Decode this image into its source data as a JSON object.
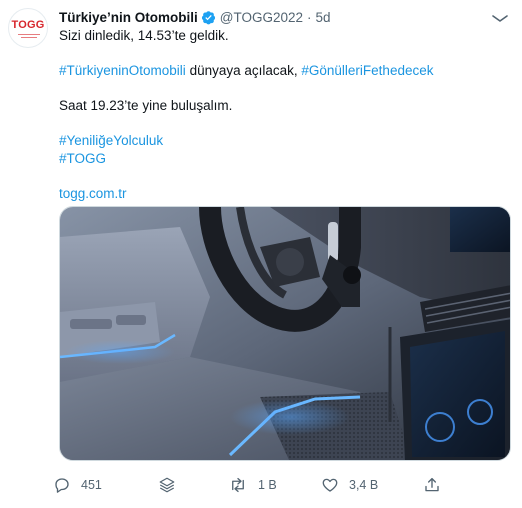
{
  "tweet": {
    "display_name": "Türkiye’nin Otomobili",
    "handle": "@TOGG2022",
    "separator": "·",
    "time": "5d",
    "avatar_logo": "TOGG",
    "lines": [
      {
        "parts": [
          {
            "t": "Sizi dinledik, 14.53’te geldik.",
            "k": "text"
          }
        ]
      },
      {
        "gap": true
      },
      {
        "parts": [
          {
            "t": "#TürkiyeninOtomobili",
            "k": "tag"
          },
          {
            "t": " dünyaya açılacak, ",
            "k": "text"
          },
          {
            "t": "#GönülleriFethedecek",
            "k": "tag"
          }
        ]
      },
      {
        "gap": true
      },
      {
        "parts": [
          {
            "t": "Saat 19.23’te yine buluşalım.",
            "k": "text"
          }
        ]
      },
      {
        "gap": true
      },
      {
        "parts": [
          {
            "t": "#YeniliğeYolculuk",
            "k": "tag"
          }
        ]
      },
      {
        "parts": [
          {
            "t": "#TOGG",
            "k": "tag"
          }
        ]
      },
      {
        "gap": true
      },
      {
        "parts": [
          {
            "t": "togg.com.tr",
            "k": "link"
          }
        ]
      }
    ]
  },
  "actions": {
    "reply_count": "451",
    "retweet_count": "1 B",
    "like_count": "3,4 B"
  },
  "icons": {
    "verified": "verified-badge-icon",
    "more": "more-options-icon",
    "reply": "reply-icon",
    "gif": "gif-icon",
    "retweet": "retweet-icon",
    "like": "heart-icon",
    "share": "share-icon"
  },
  "colors": {
    "link": "#1b95e0",
    "brand_red": "#d7262c",
    "verified": "#1da1f2",
    "muted": "#536471"
  }
}
